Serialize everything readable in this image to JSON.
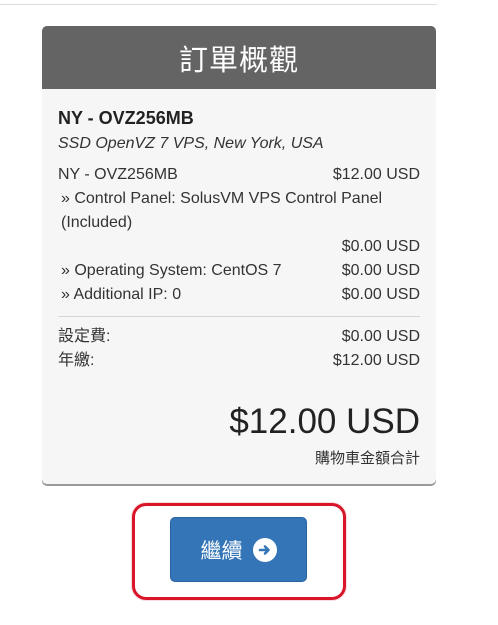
{
  "summary": {
    "title": "訂單概觀",
    "product_name": "NY - OVZ256MB",
    "product_desc": "SSD OpenVZ 7 VPS, New York, USA",
    "lines": [
      {
        "label": "NY - OVZ256MB",
        "amount": "$12.00 USD"
      },
      {
        "label": "» Control Panel: SolusVM VPS Control Panel (Included)",
        "amount": "$0.00 USD"
      },
      {
        "label": "» Operating System: CentOS 7",
        "amount": "$0.00 USD"
      },
      {
        "label": "» Additional IP: 0",
        "amount": "$0.00 USD"
      }
    ],
    "setup_fee": {
      "label": "設定費:",
      "amount": "$0.00 USD"
    },
    "annual": {
      "label": "年繳:",
      "amount": "$12.00 USD"
    },
    "total": "$12.00 USD",
    "total_label": "購物車金額合計"
  },
  "actions": {
    "continue_label": "繼續",
    "continue_icon": "arrow-circle-right-icon"
  },
  "colors": {
    "header_bg": "#646464",
    "button_bg": "#3375b6",
    "highlight_border": "#d9152a"
  }
}
